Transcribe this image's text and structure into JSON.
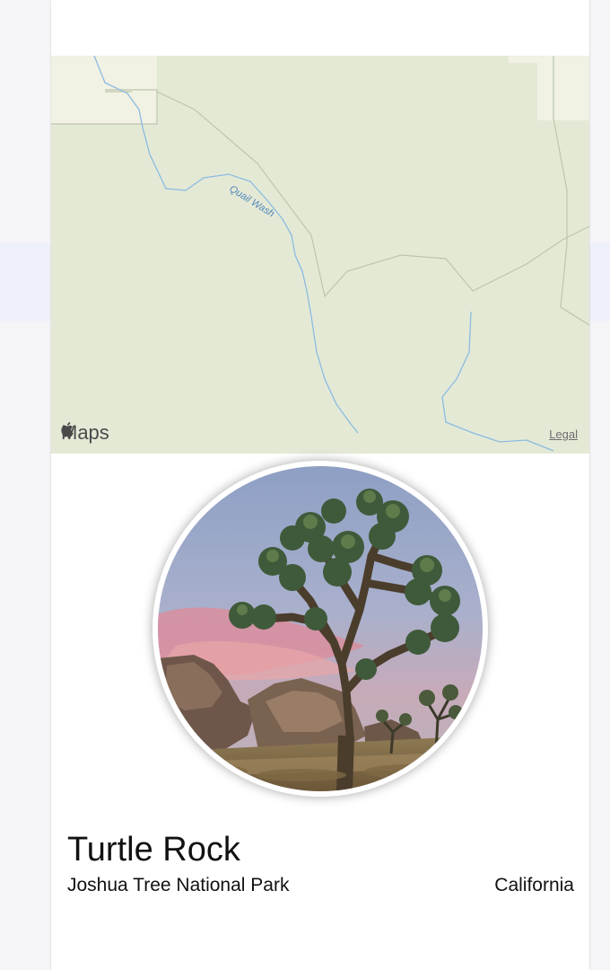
{
  "map": {
    "water_label": "Quail Wash",
    "logo_text": "Maps",
    "legal_link": "Legal",
    "colors": {
      "land": "#e4e9d6",
      "parcel": "#f1f1e4",
      "water": "#86b7dd",
      "boundary": "#b9c4a8"
    }
  },
  "landmark": {
    "name": "Turtle Rock",
    "park": "Joshua Tree National Park",
    "state": "California"
  },
  "icons": {
    "logo": "apple-logo-icon",
    "photo": "joshua-tree-photo"
  }
}
